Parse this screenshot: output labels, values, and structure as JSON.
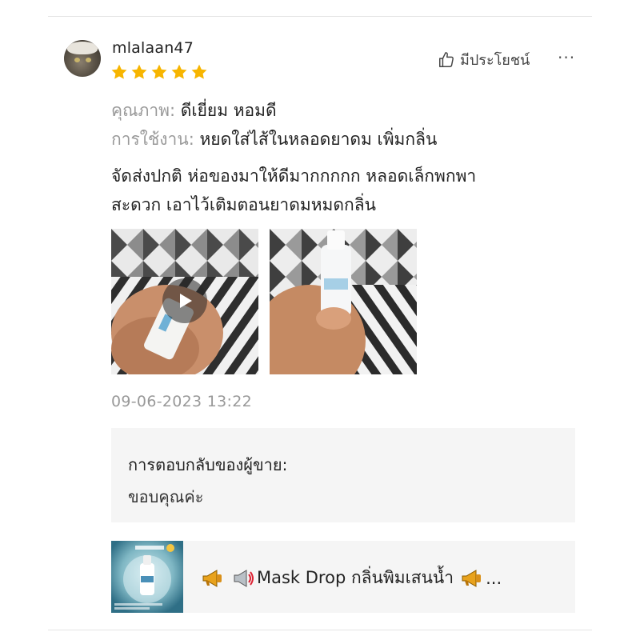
{
  "review": {
    "username": "mlalaan47",
    "rating": 5,
    "helpful_label": "มีประโยชน์",
    "quality_label": "คุณภาพ:",
    "quality_value": " ดีเยี่ยม หอมดี",
    "usage_label": "การใช้งาน:",
    "usage_value": " หยดใส่ไส้ในหลอดยาดม เพิ่มกลิ่น",
    "body_line1": "จัดส่งปกติ ห่อของมาให้ดีมากกกกก หลอดเล็กพกพา",
    "body_line2": "สะดวก เอาไว้เติมตอนยาดมหมดกลิ่น",
    "timestamp": "09-06-2023 13:22"
  },
  "media": [
    {
      "kind": "video"
    },
    {
      "kind": "image"
    }
  ],
  "seller_reply": {
    "title": "การตอบกลับของผู้ขาย:",
    "text": "ขอบคุณค่ะ"
  },
  "product": {
    "name": "Mask Drop กลิ่นพิมเสนน้ำ"
  },
  "icons": {
    "star": "star-icon",
    "helpful": "thumbs-up-icon",
    "more": "more-icon",
    "play": "play-icon",
    "megaphone": "megaphone-icon"
  },
  "colors": {
    "star": "#f7b500",
    "muted": "#999999",
    "reply_bg": "#f5f5f5"
  }
}
